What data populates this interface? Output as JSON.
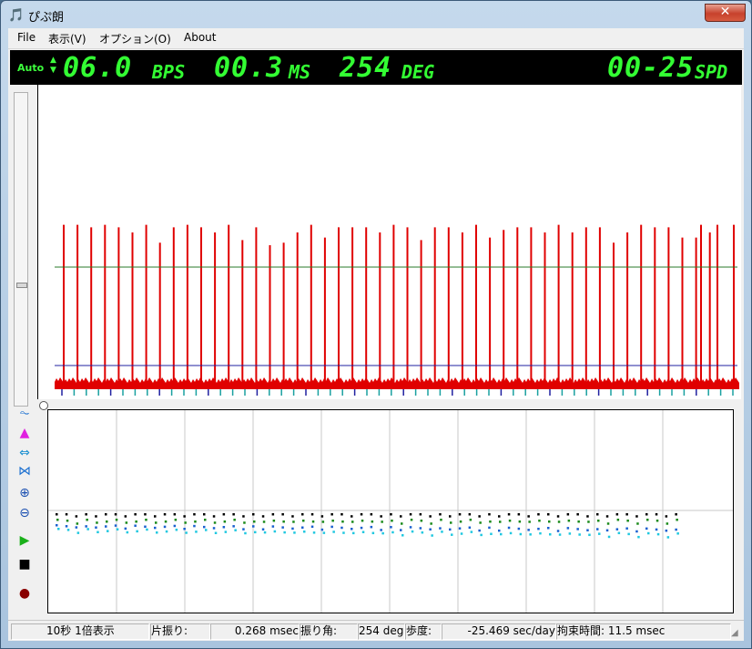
{
  "window": {
    "title": "ぴぷ朗",
    "close_label": "✕"
  },
  "menu": [
    "File",
    "表示(V)",
    "オプション(O)",
    "About"
  ],
  "readout": {
    "auto_label": "Auto",
    "bph_value": "06.0",
    "bph_unit": "BPS",
    "ms_value": "00.3",
    "ms_unit": "MS",
    "deg_value": "254",
    "deg_unit": "DEG",
    "rate_value": "00-25",
    "rate_unit": "SPD",
    "digit_color": "#33ff33"
  },
  "toolbar": [
    "waveform-toggle-icon",
    "histogram-icon",
    "expand-horizontal-icon",
    "shrink-horizontal-icon",
    "zoom-in-icon",
    "zoom-out-icon",
    "play-icon",
    "stop-icon",
    "record-icon"
  ],
  "colors": {
    "pulse": "#e00000",
    "threshold_high": "#2a7a2a",
    "threshold_low": "#2020a0",
    "tick_teal": "#1aa0a0"
  },
  "waveform": {
    "pulse_levels": [
      0.63,
      0.63,
      0.62,
      0.63,
      0.62,
      0.6,
      0.63,
      0.56,
      0.62,
      0.63,
      0.62,
      0.6,
      0.63,
      0.57,
      0.62,
      0.55,
      0.56,
      0.6,
      0.63,
      0.58,
      0.62,
      0.62,
      0.62,
      0.6,
      0.63,
      0.62,
      0.57,
      0.62,
      0.62,
      0.6,
      0.63,
      0.58,
      0.61,
      0.62,
      0.62,
      0.6,
      0.63,
      0.6,
      0.62,
      0.62,
      0.56,
      0.6,
      0.63,
      0.62,
      0.62,
      0.58,
      0.58,
      0.6
    ],
    "gap_after_index": 45,
    "extra_levels": [
      0.63,
      0.63,
      0.63
    ]
  },
  "rate_plot": {
    "series_black": [
      0.5,
      0.5,
      0.49,
      0.5,
      0.49,
      0.5,
      0.5,
      0.49,
      0.5,
      0.5,
      0.49,
      0.5,
      0.5,
      0.49,
      0.5,
      0.5,
      0.49,
      0.5,
      0.5,
      0.49,
      0.5,
      0.49,
      0.5,
      0.5,
      0.49,
      0.5,
      0.5,
      0.49,
      0.5,
      0.5,
      0.49,
      0.5,
      0.5,
      0.49,
      0.5,
      0.49,
      0.5,
      0.5,
      0.49,
      0.5,
      0.49,
      0.5,
      0.5,
      0.49,
      0.5,
      0.49,
      0.5,
      0.5,
      0.49,
      0.5,
      0.5,
      0.49,
      0.5,
      0.5,
      0.49,
      0.5,
      0.49,
      0.5,
      0.5,
      0.49,
      0.5,
      0.5,
      0.49,
      0.5
    ]
  },
  "status": {
    "span": "10秒 1倍表示",
    "amplitude_label": "片振り:",
    "amplitude_value": "0.268 msec",
    "angle_label": "振り角:",
    "angle_value": "254 deg",
    "rate_label": "歩度:",
    "rate_value": "-25.469 sec/day",
    "lock_label": "拘束時間: 11.5 msec"
  }
}
